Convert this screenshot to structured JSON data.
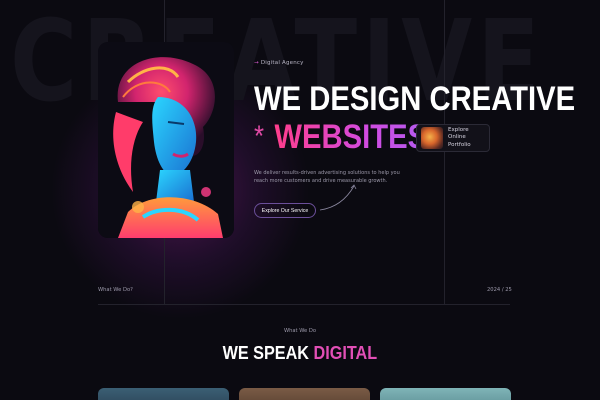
{
  "background_word": "CREATIVE",
  "hero": {
    "eyebrow": "Digital Agency",
    "headline_line1": "WE DESIGN CREATIVE",
    "headline_line2": "WEBSITES",
    "asterisk": "*",
    "description": "We deliver results-driven advertising solutions to help you reach more customers and drive measurable growth.",
    "cta_label": "Explore Our Service",
    "portfolio_chip": {
      "line1": "Explore Online",
      "line2": "Portfolio"
    }
  },
  "footer": {
    "left": "What We Do?",
    "right": "2024 / 25"
  },
  "section": {
    "subtitle": "What We Do",
    "title_plain": "WE SPEAK",
    "title_accent": "DIGITAL"
  },
  "colors": {
    "background": "#0b0a11",
    "accent_pink": "#e24fb6",
    "accent_purple": "#b35cf0",
    "text_muted": "#9c99aa"
  },
  "icons": {
    "eyebrow_arrow": "arrow-icon",
    "cta_curve": "curved-arrow-icon"
  }
}
